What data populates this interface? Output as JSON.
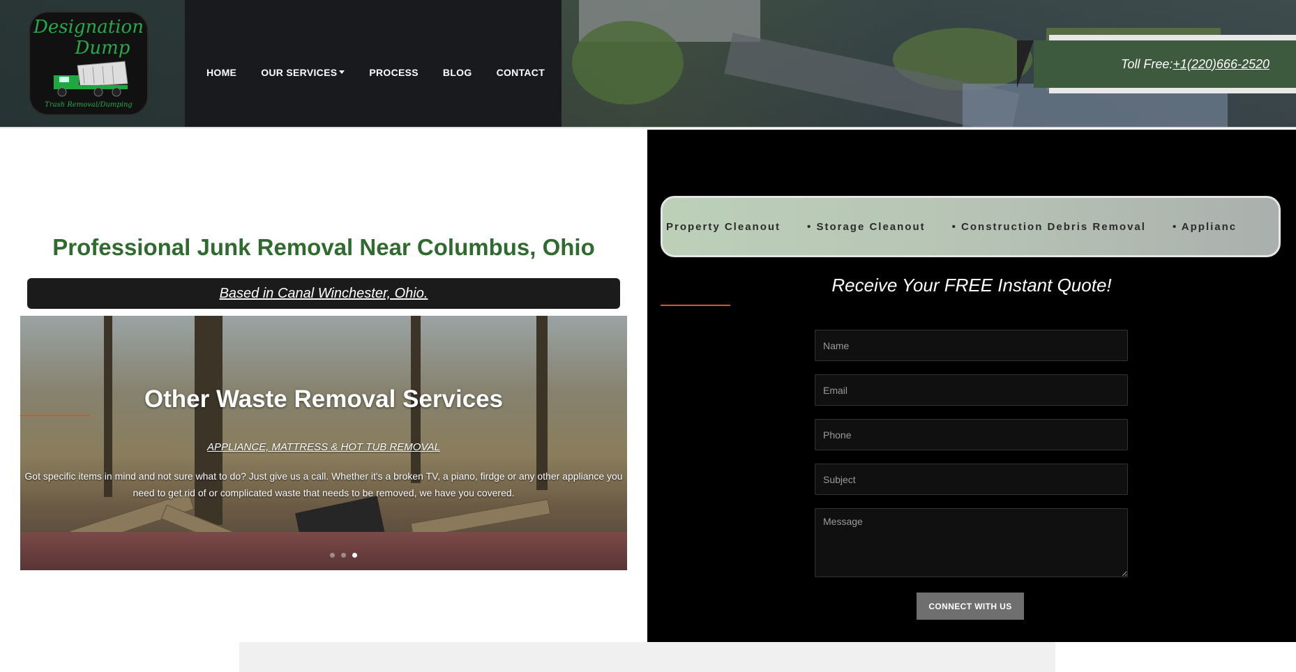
{
  "logo": {
    "line1": "Designation",
    "line2": "Dump",
    "tagline": "Trash Removal/Dumping",
    "icon": "dump-truck-icon"
  },
  "nav": {
    "items": [
      {
        "label": "HOME"
      },
      {
        "label": "OUR SERVICES"
      },
      {
        "label": "PROCESS"
      },
      {
        "label": "BLOG"
      },
      {
        "label": "CONTACT"
      }
    ]
  },
  "toll": {
    "prefix": "Toll Free:",
    "phone": "+1(220)666-2520"
  },
  "main": {
    "heading": "Professional Junk Removal Near Columbus, Ohio",
    "based": "Based in Canal Winchester, Ohio."
  },
  "slider": {
    "title": "Other Waste Removal Services",
    "subtitle": "APPLIANCE, MATTRESS & HOT TUB REMOVAL",
    "body": "Got specific items in mind and not sure what to do? Just give us a call. Whether it's a broken TV, a piano, firdge or any other appliance you need to get rid of or complicated waste that needs to be removed, we have you covered.",
    "dots": [
      false,
      false,
      true
    ]
  },
  "ticker": {
    "items": [
      "Property Cleanout",
      "• Storage Cleanout",
      "• Construction Debris Removal",
      "• Applianc"
    ]
  },
  "quote": {
    "title": "Receive Your FREE Instant Quote!",
    "fields": {
      "name": "Name",
      "email": "Email",
      "phone": "Phone",
      "subject": "Subject",
      "message": "Message"
    },
    "button": "CONNECT WITH US"
  },
  "colors": {
    "accent_green": "#2f6b2f",
    "toll_bg": "#3d5a3f",
    "accent_orange": "#d2572a"
  }
}
